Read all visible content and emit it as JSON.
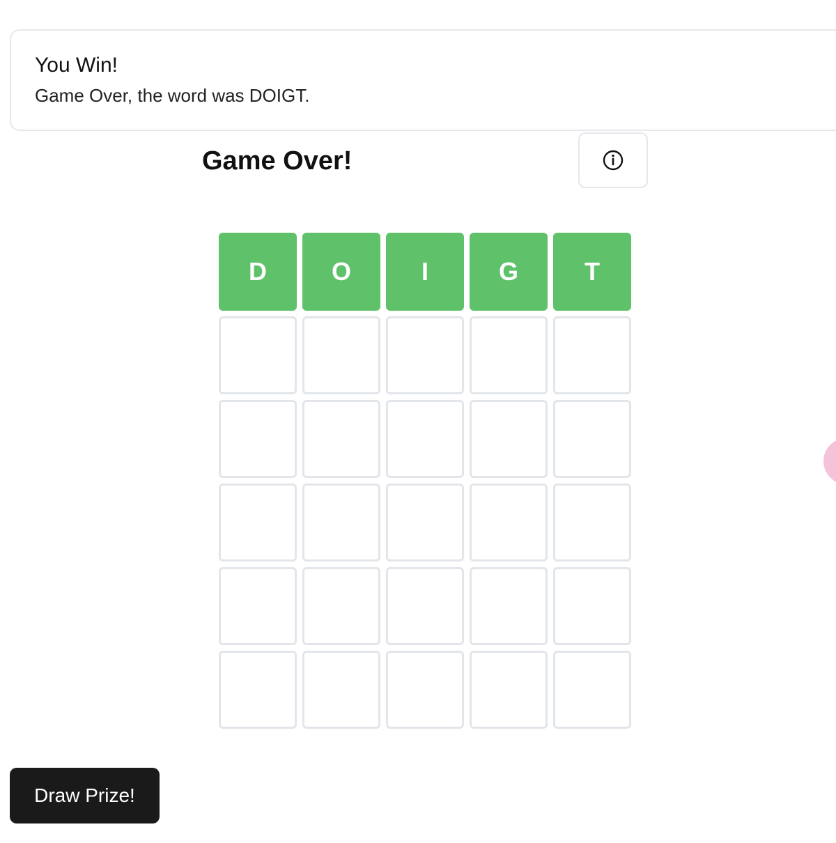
{
  "toast": {
    "title": "You Win!",
    "message": "Game Over, the word was DOIGT."
  },
  "header": {
    "title": "Game Over!",
    "info_icon": "info-circle-icon"
  },
  "board": {
    "rows": [
      [
        {
          "letter": "D",
          "state": "correct"
        },
        {
          "letter": "O",
          "state": "correct"
        },
        {
          "letter": "I",
          "state": "correct"
        },
        {
          "letter": "G",
          "state": "correct"
        },
        {
          "letter": "T",
          "state": "correct"
        }
      ],
      [
        {
          "letter": "",
          "state": "empty"
        },
        {
          "letter": "",
          "state": "empty"
        },
        {
          "letter": "",
          "state": "empty"
        },
        {
          "letter": "",
          "state": "empty"
        },
        {
          "letter": "",
          "state": "empty"
        }
      ],
      [
        {
          "letter": "",
          "state": "empty"
        },
        {
          "letter": "",
          "state": "empty"
        },
        {
          "letter": "",
          "state": "empty"
        },
        {
          "letter": "",
          "state": "empty"
        },
        {
          "letter": "",
          "state": "empty"
        }
      ],
      [
        {
          "letter": "",
          "state": "empty"
        },
        {
          "letter": "",
          "state": "empty"
        },
        {
          "letter": "",
          "state": "empty"
        },
        {
          "letter": "",
          "state": "empty"
        },
        {
          "letter": "",
          "state": "empty"
        }
      ],
      [
        {
          "letter": "",
          "state": "empty"
        },
        {
          "letter": "",
          "state": "empty"
        },
        {
          "letter": "",
          "state": "empty"
        },
        {
          "letter": "",
          "state": "empty"
        },
        {
          "letter": "",
          "state": "empty"
        }
      ],
      [
        {
          "letter": "",
          "state": "empty"
        },
        {
          "letter": "",
          "state": "empty"
        },
        {
          "letter": "",
          "state": "empty"
        },
        {
          "letter": "",
          "state": "empty"
        },
        {
          "letter": "",
          "state": "empty"
        }
      ]
    ]
  },
  "actions": {
    "draw_prize_label": "Draw Prize!"
  },
  "colors": {
    "correct": "#5fc26a",
    "empty_border": "#e2e6ea",
    "button_dark": "#1a1a1a",
    "confetti_pink": "#f5c2dc"
  }
}
